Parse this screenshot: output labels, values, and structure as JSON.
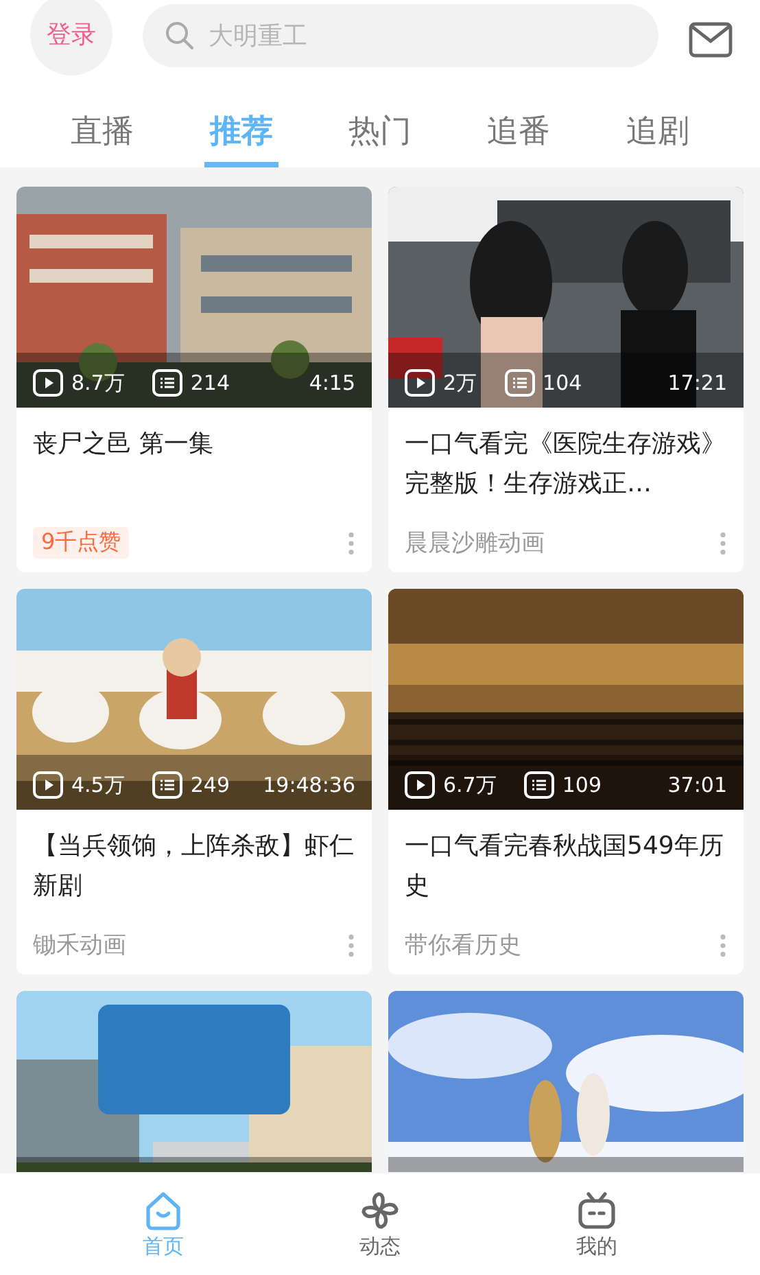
{
  "header": {
    "login": "登录",
    "search": {
      "placeholder": "大明重工"
    }
  },
  "tabs": [
    {
      "label": "直播",
      "selected": false
    },
    {
      "label": "推荐",
      "selected": true
    },
    {
      "label": "热门",
      "selected": false
    },
    {
      "label": "追番",
      "selected": false
    },
    {
      "label": "追剧",
      "selected": false
    }
  ],
  "videos": [
    {
      "kind": "full",
      "views": "8.7万",
      "danmaku": "214",
      "duration": "4:15",
      "title": "丧尸之邑 第一集",
      "footer": {
        "kind": "badge",
        "text": "9千点赞"
      }
    },
    {
      "kind": "full",
      "views": "2万",
      "danmaku": "104",
      "duration": "17:21",
      "title": "一口气看完《医院生存游戏》完整版！生存游戏正…",
      "footer": {
        "kind": "author",
        "text": "晨晨沙雕动画"
      }
    },
    {
      "kind": "full",
      "views": "4.5万",
      "danmaku": "249",
      "duration": "19:48:36",
      "title": "【当兵领饷，上阵杀敌】虾仁新剧",
      "footer": {
        "kind": "author",
        "text": "锄禾动画"
      }
    },
    {
      "kind": "full",
      "views": "6.7万",
      "danmaku": "109",
      "duration": "37:01",
      "title": "一口气看完春秋战国549年历史",
      "footer": {
        "kind": "author",
        "text": "带你看历史"
      }
    },
    {
      "kind": "picture"
    },
    {
      "kind": "picture"
    }
  ],
  "nav": [
    {
      "kind": "home",
      "label": "首页",
      "selected": true
    },
    {
      "kind": "pinwheel",
      "label": "动态",
      "selected": false
    },
    {
      "kind": "tv",
      "label": "我的",
      "selected": false
    }
  ]
}
